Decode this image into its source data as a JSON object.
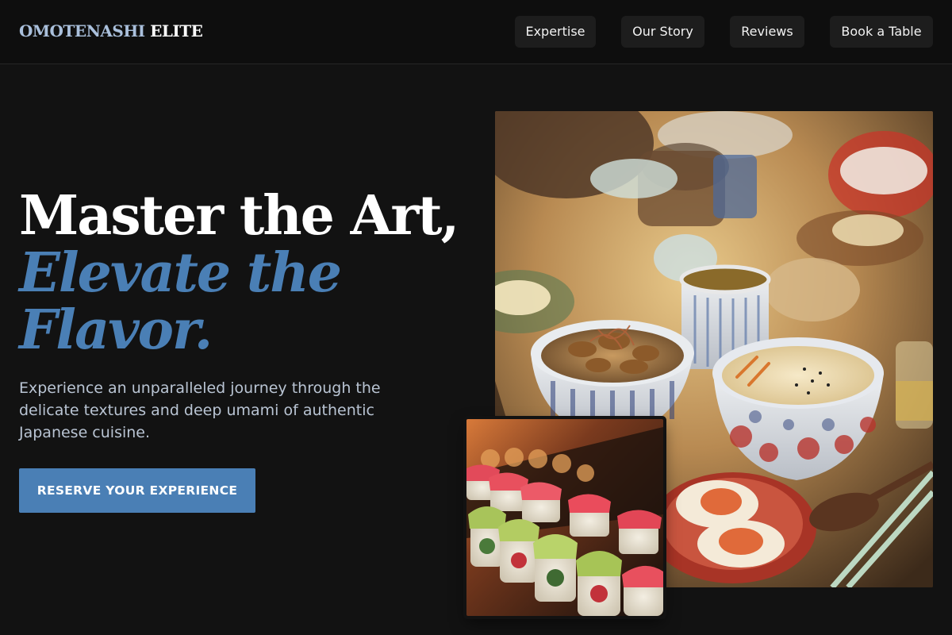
{
  "brand": {
    "part1": "OMOTENASHI",
    "part2": "ELITE"
  },
  "nav": {
    "expertise": "Expertise",
    "our_story": "Our Story",
    "reviews": "Reviews",
    "book": "Book a Table"
  },
  "hero": {
    "headline_line1": "Master the Art,",
    "headline_line2": "Elevate the Flavor.",
    "description": "Experience an unparalleled journey through the delicate textures and deep umami of authentic Japanese cuisine.",
    "cta": "RESERVE YOUR EXPERIENCE"
  },
  "colors": {
    "accent": "#4a7fb5",
    "background": "#121212",
    "logo_light": "#aac0dc"
  }
}
